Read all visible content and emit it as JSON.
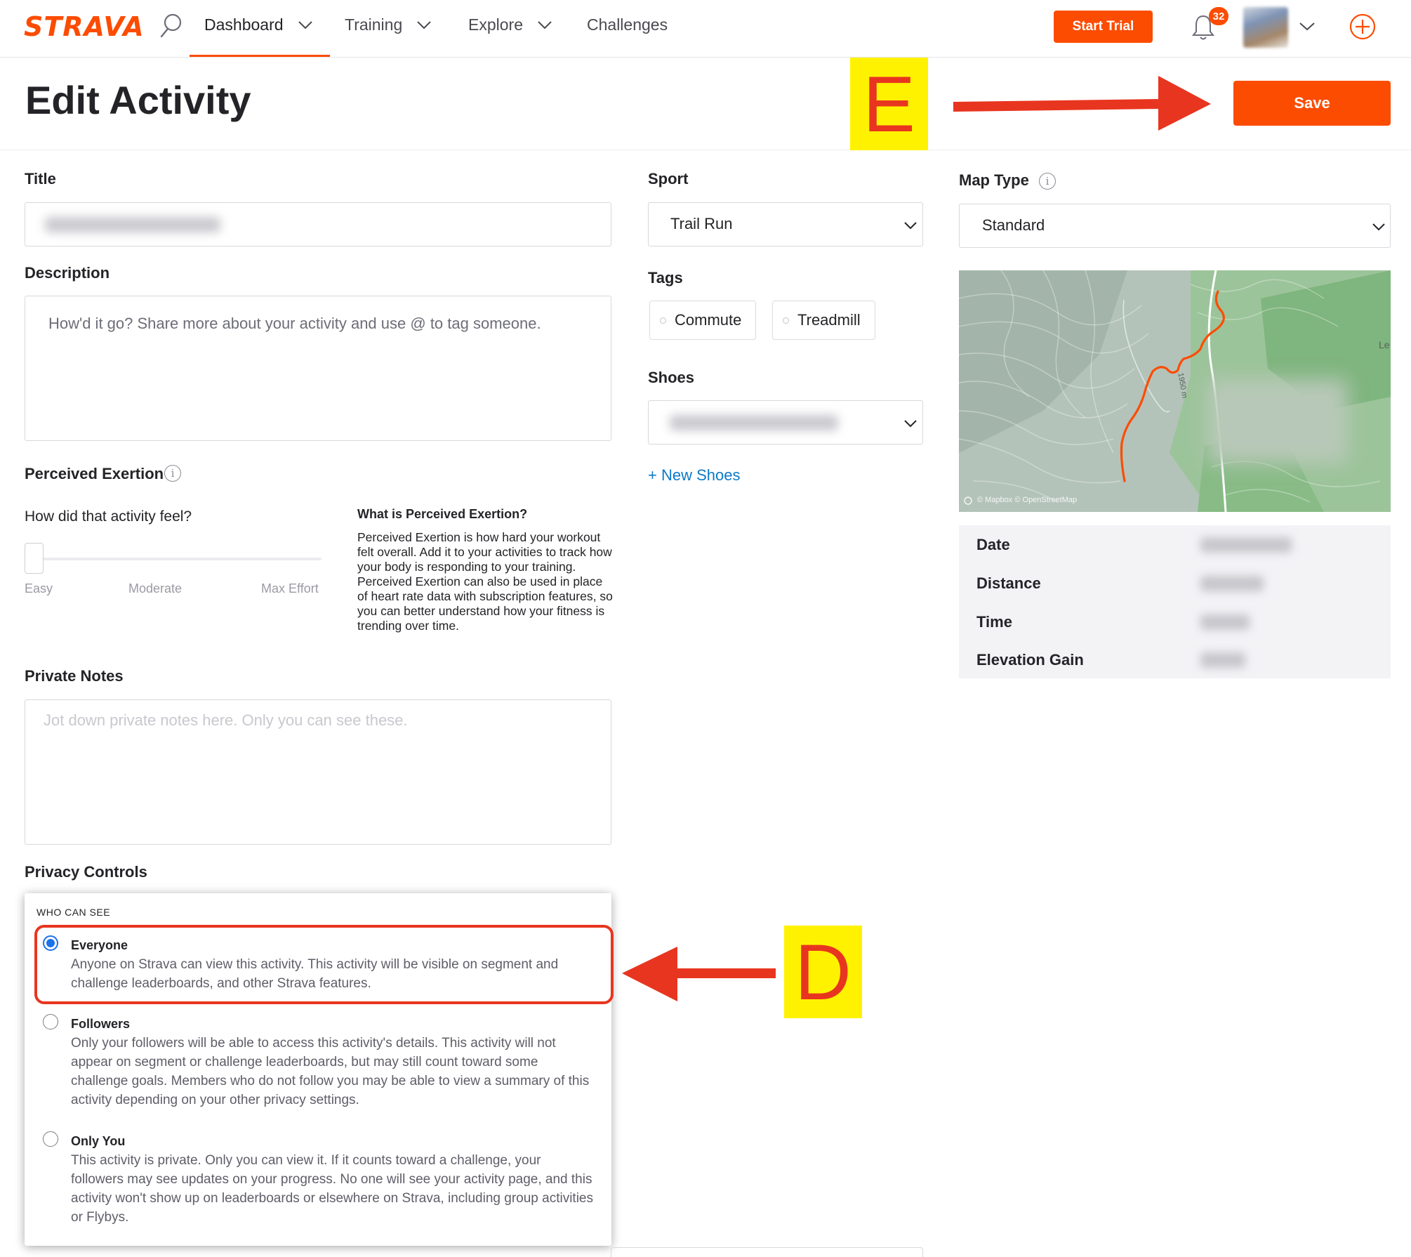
{
  "nav": {
    "logo": "STRAVA",
    "items": [
      {
        "label": "Dashboard",
        "has_dropdown": true,
        "active": true
      },
      {
        "label": "Training",
        "has_dropdown": true,
        "active": false
      },
      {
        "label": "Explore",
        "has_dropdown": true,
        "active": false
      },
      {
        "label": "Challenges",
        "has_dropdown": false,
        "active": false
      }
    ],
    "start_trial_label": "Start Trial",
    "notification_count": "32",
    "icons": [
      "search-icon",
      "bell-icon",
      "chevron-down-icon",
      "plus-circle-icon"
    ]
  },
  "header": {
    "title": "Edit Activity",
    "save_label": "Save"
  },
  "annotations": {
    "e": "E",
    "d": "D",
    "color": "#e8351f",
    "highlight": "#fff200"
  },
  "form": {
    "title_label": "Title",
    "title_value": "",
    "description_label": "Description",
    "description_placeholder": "How'd it go? Share more about your activity and use @ to tag someone.",
    "perceived_exertion": {
      "label": "Perceived Exertion",
      "question": "How did that activity feel?",
      "scale_labels": [
        "Easy",
        "Moderate",
        "Max Effort"
      ],
      "value": 0,
      "info_title": "What is Perceived Exertion?",
      "info_body": "Perceived Exertion is how hard your workout felt overall. Add it to your activities to track how your body is responding to your training. Perceived Exertion can also be used in place of heart rate data with subscription features, so you can better understand how your fitness is trending over time."
    },
    "private_notes_label": "Private Notes",
    "private_notes_placeholder": "Jot down private notes here. Only you can see these.",
    "privacy": {
      "label": "Privacy Controls",
      "heading": "WHO CAN SEE",
      "options": [
        {
          "title": "Everyone",
          "checked": true,
          "desc": "Anyone on Strava can view this activity. This activity will be visible on segment and challenge leaderboards, and other Strava features."
        },
        {
          "title": "Followers",
          "checked": false,
          "desc": "Only your followers will be able to access this activity's details. This activity will not appear on segment or challenge leaderboards, but may still count toward some challenge goals. Members who do not follow you may be able to view a summary of this activity depending on your other privacy settings."
        },
        {
          "title": "Only You",
          "checked": false,
          "desc": "This activity is private. Only you can view it. If it counts toward a challenge, your followers may see updates on your progress. No one will see your activity page, and this activity won't show up on leaderboards or elsewhere on Strava, including group activities or Flybys."
        }
      ]
    },
    "sport_label": "Sport",
    "sport_value": "Trail Run",
    "tags_label": "Tags",
    "tags": [
      "Commute",
      "Treadmill"
    ],
    "shoes_label": "Shoes",
    "shoes_value": "",
    "new_shoes_label": "+ New Shoes",
    "map_type_label": "Map Type",
    "map_type_value": "Standard"
  },
  "map": {
    "attribution": "© Mapbox © OpenStreetMap",
    "contour_label": "1950 m",
    "edge_label": "Le",
    "route_color": "#fc4c02"
  },
  "stats": {
    "labels": [
      "Date",
      "Distance",
      "Time",
      "Elevation Gain"
    ]
  },
  "colors": {
    "brand": "#fc4c02",
    "link": "#0d79c7",
    "radio_selected": "#1a73e8"
  }
}
